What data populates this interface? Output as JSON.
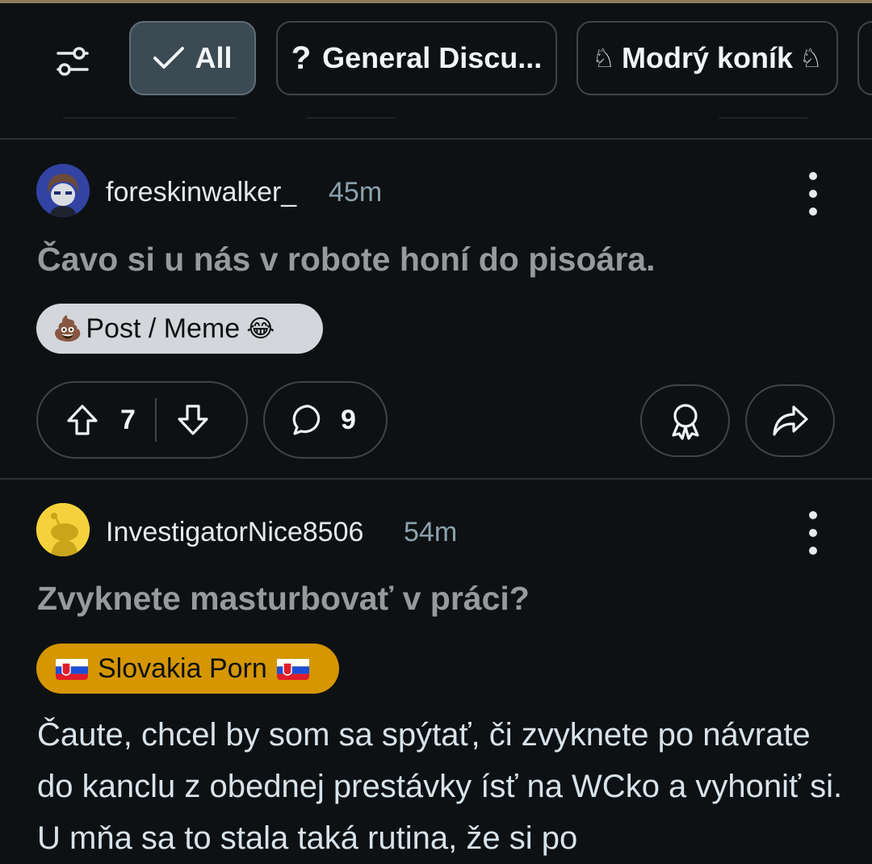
{
  "filters": {
    "items": [
      {
        "label": "All",
        "selected": true
      },
      {
        "label": "General Discu...",
        "icon": "question-mark-icon"
      },
      {
        "label": "Modrý koník",
        "icon": "chess-knight-icon"
      }
    ]
  },
  "posts": [
    {
      "author": "foreskinwalker_",
      "time": "45m",
      "title": "Čavo si u nás v robote honí do pisoára.",
      "flair": "Post / Meme",
      "flair_emoji_before": "💩",
      "flair_emoji_after": "😂",
      "upvotes": "7",
      "comments": "9"
    },
    {
      "author": "InvestigatorNice8506",
      "time": "54m",
      "title": "Zvyknete masturbovať v práci?",
      "flair": "Slovakia Porn",
      "flair_color": "#d59600",
      "body": "Čaute, chcel by som sa spýtať, či zvyknete po návrate do kanclu z obednej prestávky ísť na WCko a vyhoniť si. U mňa sa to stala taká rutina, že si po"
    }
  ],
  "colors": {
    "background": "#0e1113",
    "selected_chip": "#3c4a54",
    "title_gray": "#979a9c",
    "timestamp": "#8ba2ad"
  }
}
